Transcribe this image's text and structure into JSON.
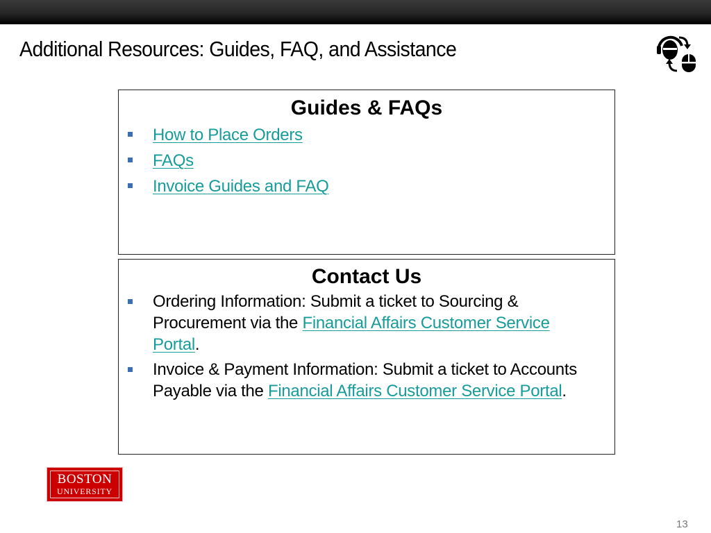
{
  "slide": {
    "title": "Additional Resources: Guides, FAQ, and Assistance",
    "page_number": "13",
    "header_icon": "customer-support-headset-icon"
  },
  "guides_panel": {
    "heading": "Guides & FAQs",
    "links": [
      {
        "label": "How to Place Orders"
      },
      {
        "label": "FAQs"
      },
      {
        "label": "Invoice Guides and FAQ"
      }
    ]
  },
  "contact_panel": {
    "heading": "Contact Us",
    "items": [
      {
        "text_before": "Ordering Information: Submit a ticket to Sourcing & Procurement via the ",
        "link": "Financial Affairs Customer Service Portal",
        "text_after": "."
      },
      {
        "text_before": "Invoice & Payment Information: Submit a ticket to Accounts Payable via the ",
        "link": "Financial Affairs Customer Service Portal",
        "text_after": "."
      }
    ]
  },
  "logo": {
    "line1": "BOSTON",
    "line2": "UNIVERSITY"
  },
  "colors": {
    "link": "#179c9a",
    "bullet": "#3a6fb6",
    "logo_red": "#cc0000"
  }
}
